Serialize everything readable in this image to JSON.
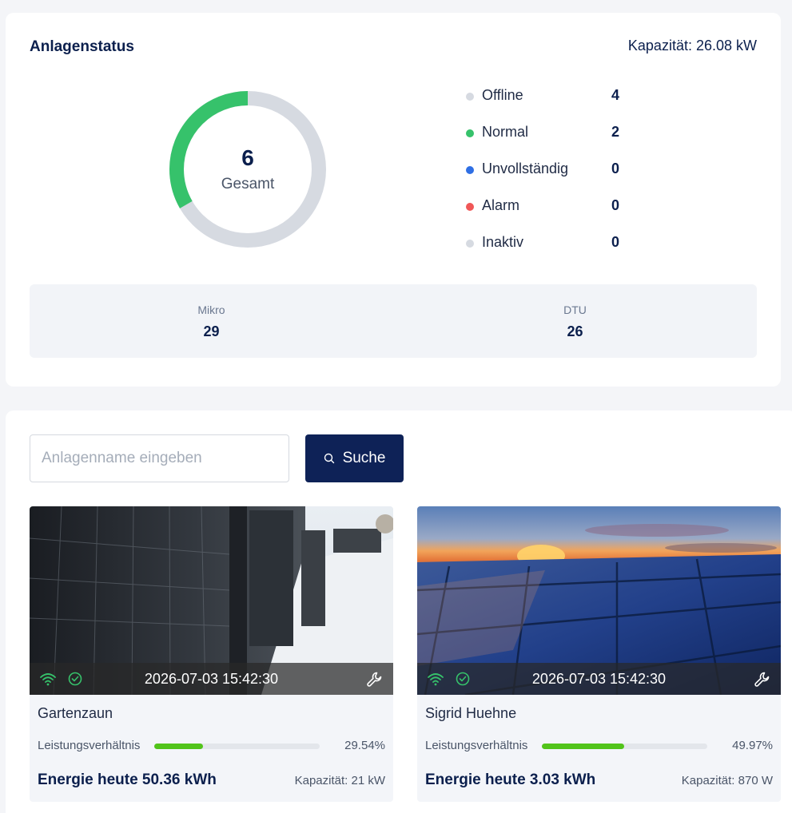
{
  "status": {
    "title": "Anlagenstatus",
    "capacity": "Kapazität: 26.08 kW",
    "total": "6",
    "total_label": "Gesamt",
    "normal_fraction": 0.3333,
    "legend": [
      {
        "label": "Offline",
        "value": "4",
        "color": "#d6dae1"
      },
      {
        "label": "Normal",
        "value": "2",
        "color": "#36c26b"
      },
      {
        "label": "Unvollständig",
        "value": "0",
        "color": "#2f6fe4"
      },
      {
        "label": "Alarm",
        "value": "0",
        "color": "#f05757"
      },
      {
        "label": "Inaktiv",
        "value": "0",
        "color": "#d6dae1"
      }
    ],
    "counts": [
      {
        "label": "Mikro",
        "value": "29"
      },
      {
        "label": "DTU",
        "value": "26"
      }
    ]
  },
  "search": {
    "placeholder": "Anlagenname eingeben",
    "button_label": "Suche"
  },
  "plants": [
    {
      "name": "Gartenzaun",
      "timestamp": "2026-07-03 15:42:30",
      "ratio_label": "Leistungsverhältnis",
      "ratio_value": "29.54%",
      "ratio": 0.2954,
      "energy": "Energie heute 50.36 kWh",
      "capacity": "Kapazität: 21 kW"
    },
    {
      "name": "Sigrid Huehne",
      "timestamp": "2026-07-03 15:42:30",
      "ratio_label": "Leistungsverhältnis",
      "ratio_value": "49.97%",
      "ratio": 0.4997,
      "energy": "Energie heute 3.03 kWh",
      "capacity": "Kapazität: 870 W"
    }
  ],
  "colors": {
    "accent": "#0e2257",
    "online": "#36c26b",
    "progress": "#52c41a"
  }
}
